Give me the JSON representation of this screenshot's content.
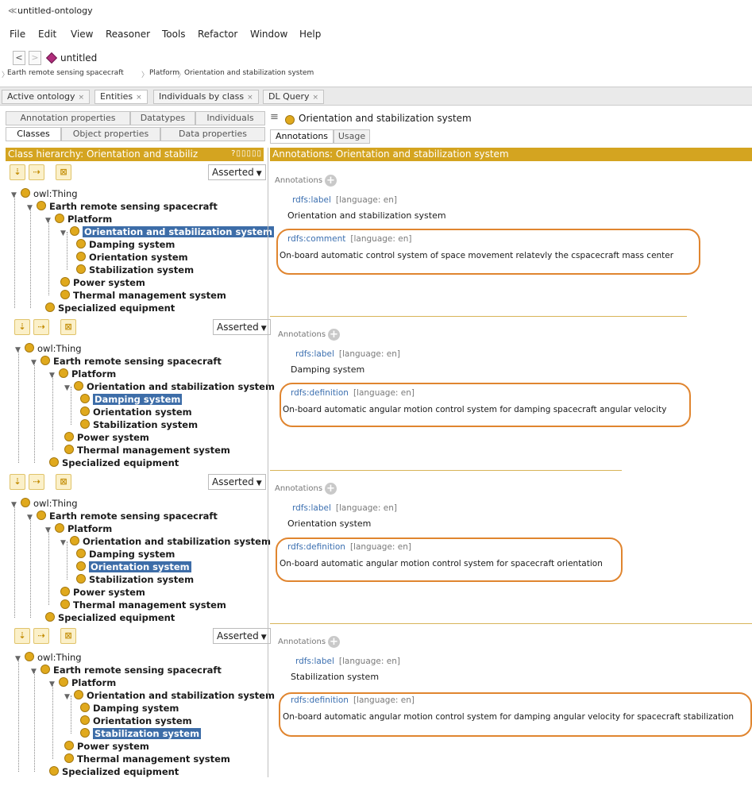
{
  "app": {
    "window_title": "untitled-ontology"
  },
  "menu": [
    "File",
    "Edit",
    "View",
    "Reasoner",
    "Tools",
    "Refactor",
    "Window",
    "Help"
  ],
  "nav": {
    "back": "<",
    "forward": ">",
    "ontology": "untitled"
  },
  "breadcrumb": [
    "Earth remote sensing spacecraft",
    "Platform",
    "Orientation and stabilization system"
  ],
  "tabs": [
    {
      "label": "Active ontology",
      "close": "×"
    },
    {
      "label": "Entities",
      "close": "×"
    },
    {
      "label": "Individuals by class",
      "close": "×"
    },
    {
      "label": "DL Query",
      "close": "×"
    }
  ],
  "subtabs_row1": [
    "Annotation properties",
    "Datatypes",
    "Individuals"
  ],
  "subtabs_row2": [
    "Classes",
    "Object properties",
    "Data properties"
  ],
  "hierarchy_header": "Class hierarchy: Orientation and stabiliz",
  "hierarchy_controls": "?▯▯▯▯▯",
  "right_header": {
    "title": "Orientation and stabilization system"
  },
  "right_tabs": [
    "Annotations",
    "Usage"
  ],
  "annotations_header": "Annotations: Orientation and stabilization system",
  "asserted": "Asserted",
  "tree_labels": {
    "thing": "owl:Thing",
    "earth": "Earth remote sensing spacecraft",
    "platform": "Platform",
    "orientstab": "Orientation and stabilization system",
    "damping": "Damping system",
    "orientation": "Orientation system",
    "stabilization": "Stabilization system",
    "power": "Power system",
    "thermal": "Thermal management system",
    "special": "Specialized equipment"
  },
  "panels": [
    {
      "selected": "orientstab",
      "annotations_label": "Annotations",
      "label_prop": "rdfs:label",
      "label_lang": "[language: en]",
      "label_value": "Orientation and stabilization system",
      "second_prop": "rdfs:comment",
      "second_lang": "[language: en]",
      "second_value": "On-board automatic control system of space movement relatevly the cspacecraft mass center"
    },
    {
      "selected": "damping",
      "annotations_label": "Annotations",
      "label_prop": "rdfs:label",
      "label_lang": "[language: en]",
      "label_value": "Damping system",
      "second_prop": "rdfs:definition",
      "second_lang": "[language: en]",
      "second_value": "On-board automatic angular motion control system for damping spacecraft angular velocity"
    },
    {
      "selected": "orientation",
      "annotations_label": "Annotations",
      "label_prop": "rdfs:label",
      "label_lang": "[language: en]",
      "label_value": "Orientation system",
      "second_prop": "rdfs:definition",
      "second_lang": "[language: en]",
      "second_value": "On-board automatic angular motion control system for spacecraft orientation"
    },
    {
      "selected": "stabilization",
      "annotations_label": "Annotations",
      "label_prop": "rdfs:label",
      "label_lang": "[language: en]",
      "label_value": "Stabilization system",
      "second_prop": "rdfs:definition",
      "second_lang": "[language: en]",
      "second_value": "On-board automatic angular motion control system for damping angular velocity for spacecraft stabilization"
    }
  ],
  "colors": {
    "accent": "#d4a420",
    "selection": "#3d6da8",
    "highlight_oval": "#e0852f",
    "class_dot": "#e0a91d"
  }
}
